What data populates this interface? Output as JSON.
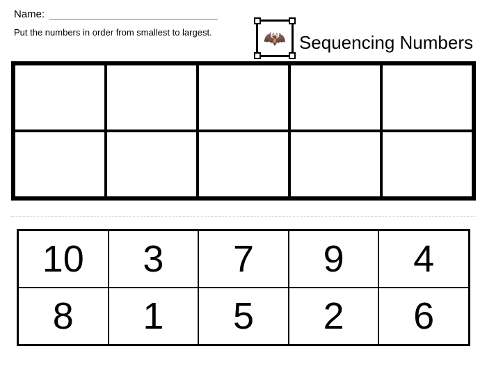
{
  "header": {
    "name_label": "Name:",
    "name_line": "_______________________________",
    "instruction": "Put the numbers in order from smallest to largest.",
    "title": "Sequencing Numbers",
    "icon_glyph": "🦇"
  },
  "answer_grid": {
    "rows": 2,
    "cols": 5,
    "cells": [
      "",
      "",
      "",
      "",
      "",
      "",
      "",
      "",
      "",
      ""
    ]
  },
  "number_bank": {
    "rows": 2,
    "cols": 5,
    "cells": [
      "10",
      "3",
      "7",
      "9",
      "4",
      "8",
      "1",
      "5",
      "2",
      "6"
    ]
  }
}
